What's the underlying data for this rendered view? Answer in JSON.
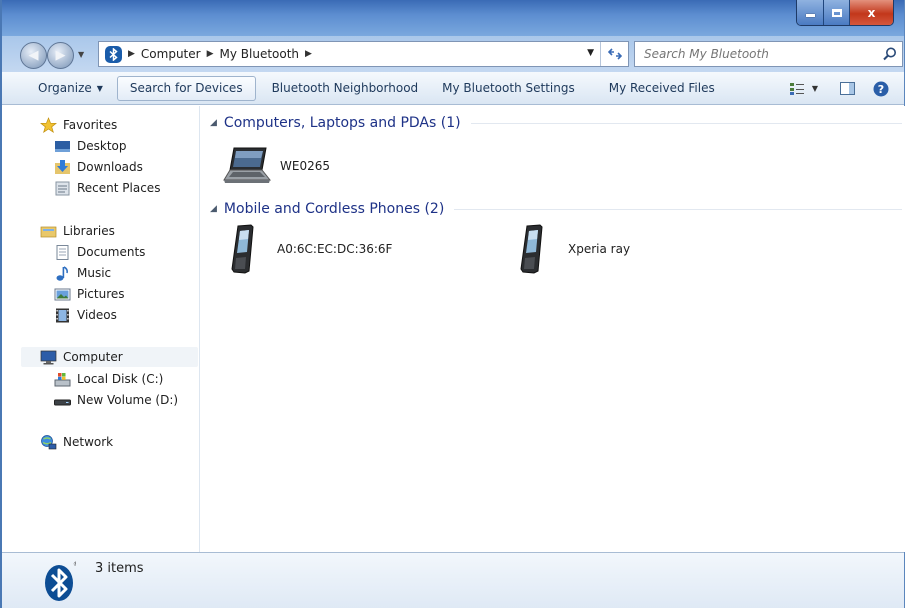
{
  "window": {
    "title_buttons": {
      "minimize_icon": "minimize-icon",
      "maximize_icon": "maximize-icon",
      "close_label": "x"
    }
  },
  "address": {
    "crumbs": [
      "Computer",
      "My Bluetooth"
    ],
    "search_placeholder": "Search My Bluetooth"
  },
  "toolbar": {
    "organize": "Organize",
    "search_for_devices": "Search for Devices",
    "bluetooth_neighborhood": "Bluetooth Neighborhood",
    "my_bluetooth_settings": "My Bluetooth Settings",
    "my_received_files": "My Received Files",
    "help_icon": "help-icon",
    "view_icon": "view-options-icon",
    "preview_icon": "preview-pane-icon"
  },
  "sidebar": {
    "favorites": {
      "label": "Favorites",
      "items": [
        "Desktop",
        "Downloads",
        "Recent Places"
      ]
    },
    "libraries": {
      "label": "Libraries",
      "items": [
        "Documents",
        "Music",
        "Pictures",
        "Videos"
      ]
    },
    "computer": {
      "label": "Computer",
      "items": [
        "Local Disk (C:)",
        "New Volume (D:)"
      ]
    },
    "network": {
      "label": "Network"
    }
  },
  "content": {
    "groups": [
      {
        "title": "Computers, Laptops and PDAs (1)",
        "devices": [
          {
            "name": "WE0265",
            "icon": "laptop-icon"
          }
        ]
      },
      {
        "title": "Mobile and Cordless Phones (2)",
        "devices": [
          {
            "name": "A0:6C:EC:DC:36:6F",
            "icon": "phone-icon"
          },
          {
            "name": "Xperia ray",
            "icon": "phone-icon"
          }
        ]
      }
    ]
  },
  "status": {
    "count": "3 items"
  },
  "colors": {
    "title_bar": "#5c8dd0",
    "group_title": "#1e3287",
    "close_button": "#c2371b",
    "bluetooth": "#1a5caa"
  }
}
